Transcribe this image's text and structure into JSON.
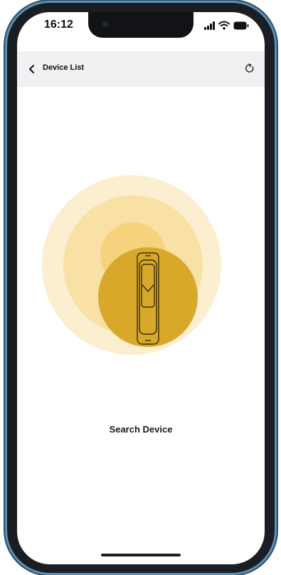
{
  "status_bar": {
    "time": "16:12",
    "icons": [
      "signal-icon",
      "wifi-icon",
      "battery-icon"
    ]
  },
  "nav": {
    "back_icon": "chevron-left-icon",
    "title": "Device List",
    "refresh_icon": "refresh-icon"
  },
  "main": {
    "illustration": "fitness-band-icon",
    "search_label": "Search Device"
  },
  "colors": {
    "ring_outer": "#fcefcf",
    "ring_mid": "#f9e1a6",
    "ring_inner": "#f6d27c",
    "device_circle": "#d8a82a",
    "nav_background": "#f1f1f3",
    "phone_frame": "#5a8fb6"
  }
}
